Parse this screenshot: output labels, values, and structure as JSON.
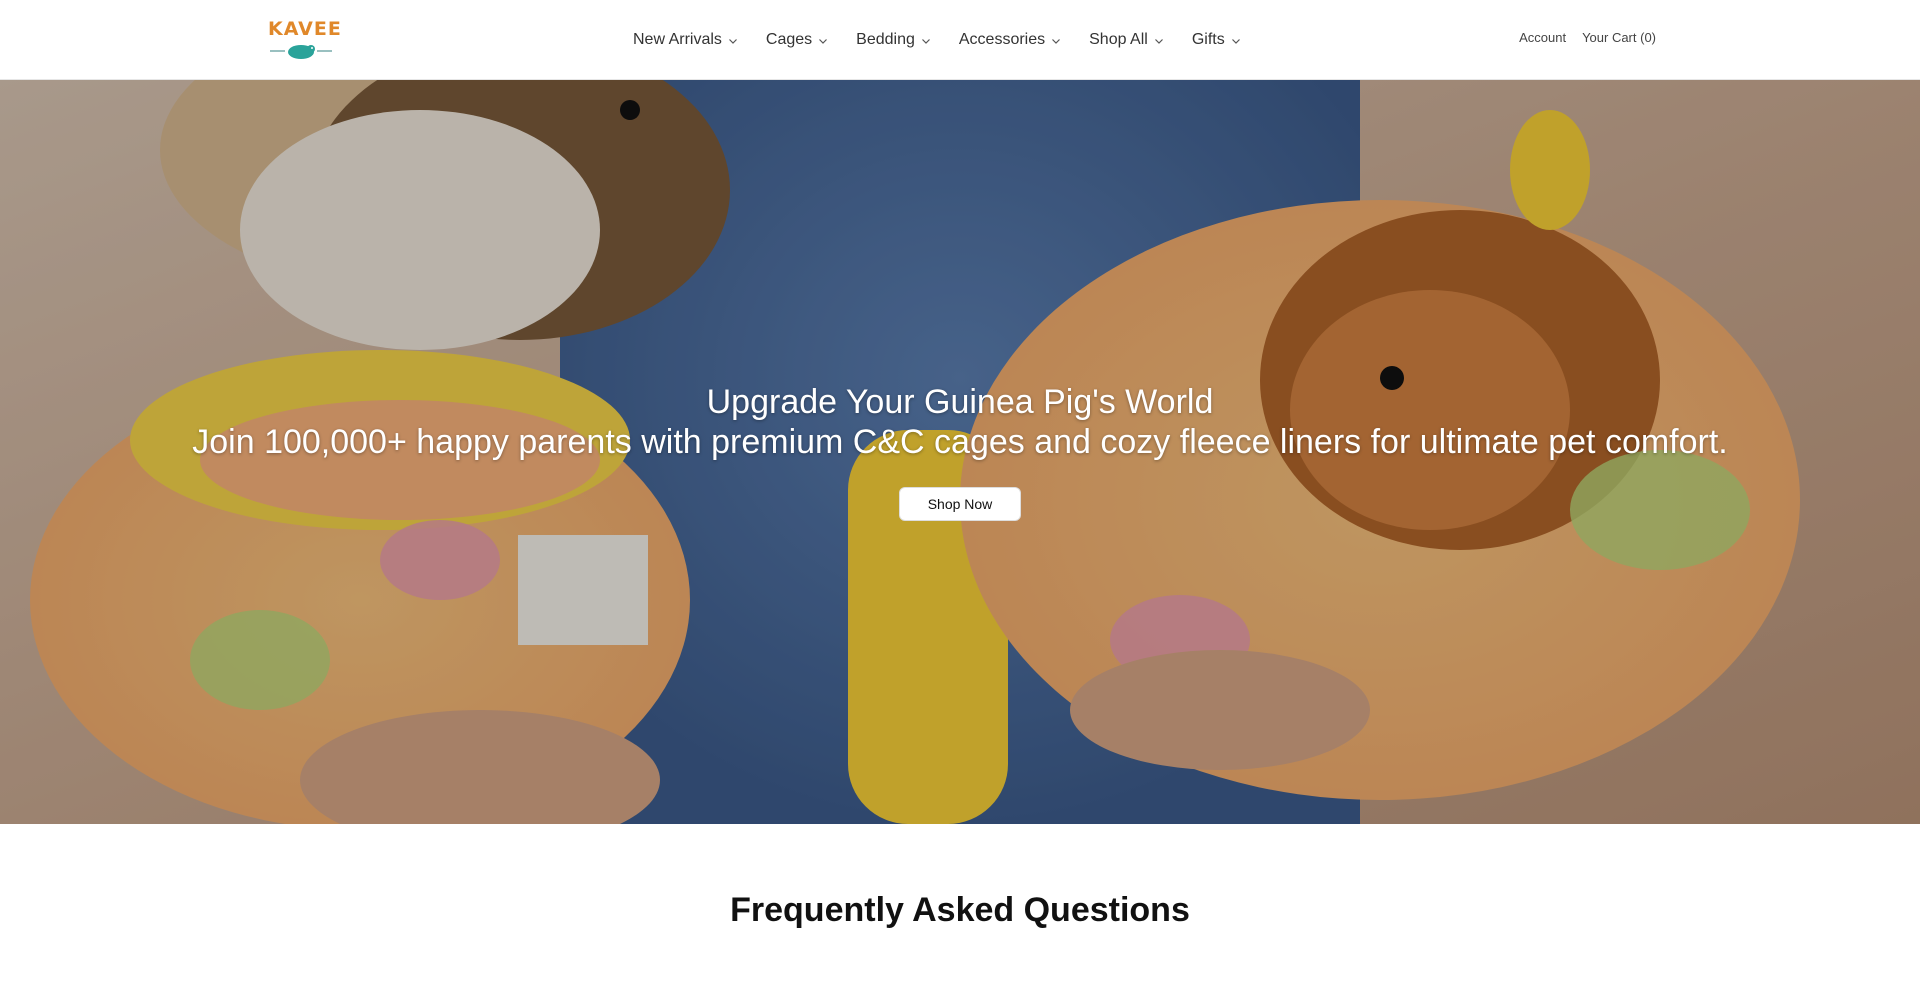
{
  "brand": {
    "logo_text": "KAVEE"
  },
  "nav": {
    "items": [
      {
        "label": "New Arrivals"
      },
      {
        "label": "Cages"
      },
      {
        "label": "Bedding"
      },
      {
        "label": "Accessories"
      },
      {
        "label": "Shop All"
      },
      {
        "label": "Gifts"
      }
    ]
  },
  "utility": {
    "account_label": "Account",
    "cart_label": "Your Cart (0)"
  },
  "hero": {
    "title": "Upgrade Your Guinea Pig's World",
    "subtitle": "Join 100,000+ happy parents with premium C&C cages and cozy fleece liners for ultimate pet comfort.",
    "cta_label": "Shop Now"
  },
  "faq": {
    "title": "Frequently Asked Questions"
  },
  "colors": {
    "brand_orange": "#e0882a",
    "brand_teal": "#2aa39a"
  },
  "icons": {
    "nav_dropdown": "chevron-down-icon"
  }
}
